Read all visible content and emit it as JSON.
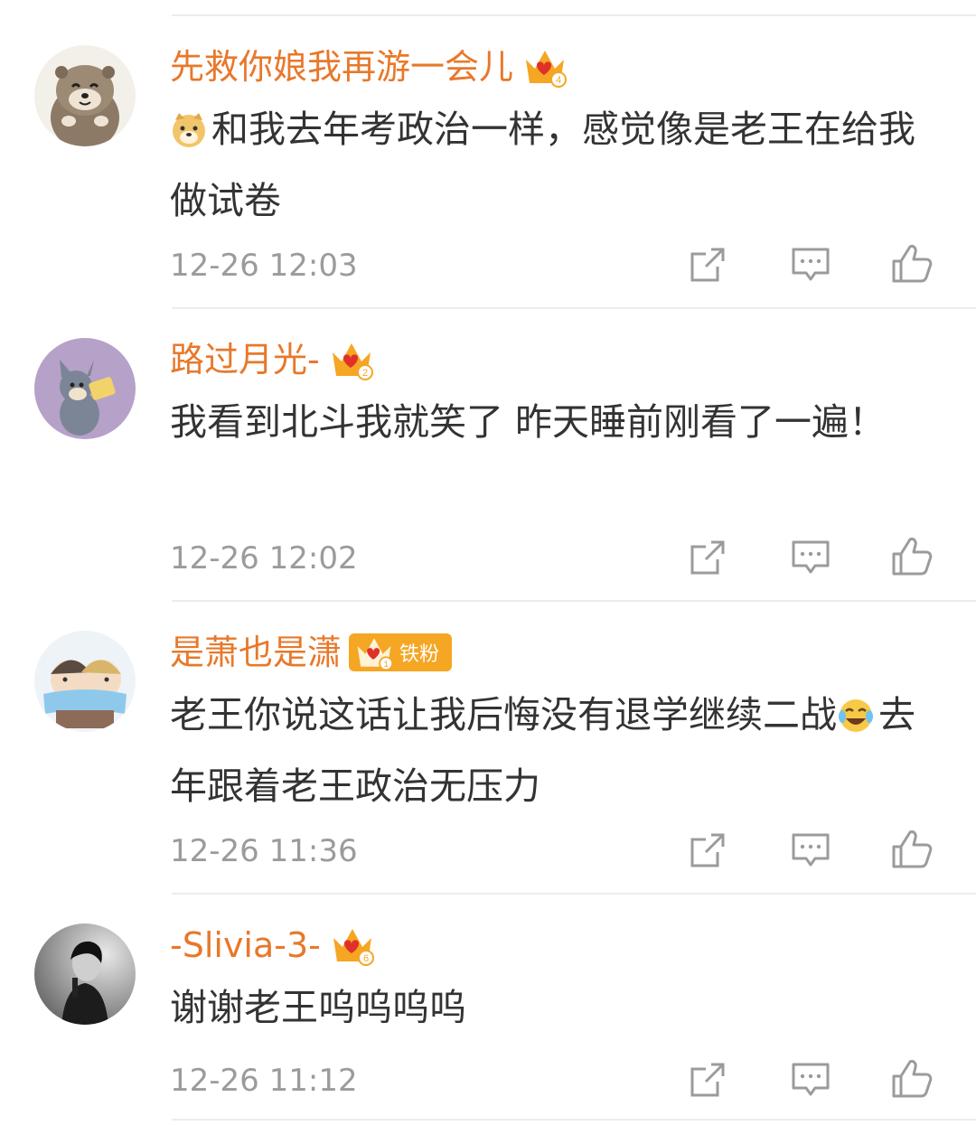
{
  "comments": [
    {
      "username": "先救你娘我再游一会儿",
      "level": "4",
      "text": "和我去年考政治一样，感觉像是老王在给我做试卷",
      "emoji": "doge-emoji",
      "time": "12-26 12:03"
    },
    {
      "username": "路过月光-",
      "level": "2",
      "text": "我看到北斗我就笑了 昨天睡前刚看了一遍！",
      "time": "12-26 12:02"
    },
    {
      "username": "是萧也是潇",
      "level": "1",
      "badge": "铁粉",
      "text_before_emoji": "老王你说这话让我后悔没有退学继续二战",
      "emoji": "laugh-cry-emoji",
      "text_after_emoji": "去年跟着老王政治无压力",
      "time": "12-26 11:36"
    },
    {
      "username": "-Slivia-3-",
      "level": "6",
      "text": "谢谢老王呜呜呜呜",
      "time": "12-26 11:12"
    }
  ],
  "icons": {
    "share": "share-icon",
    "reply": "comment-icon",
    "like": "like-icon",
    "crown": "crown-icon"
  },
  "colors": {
    "username": "#e8782a",
    "crown": "#f5a623",
    "crown_heart": "#e0302a",
    "text": "#333333",
    "time": "#9b9b9b",
    "icon": "#9b9b9b"
  }
}
